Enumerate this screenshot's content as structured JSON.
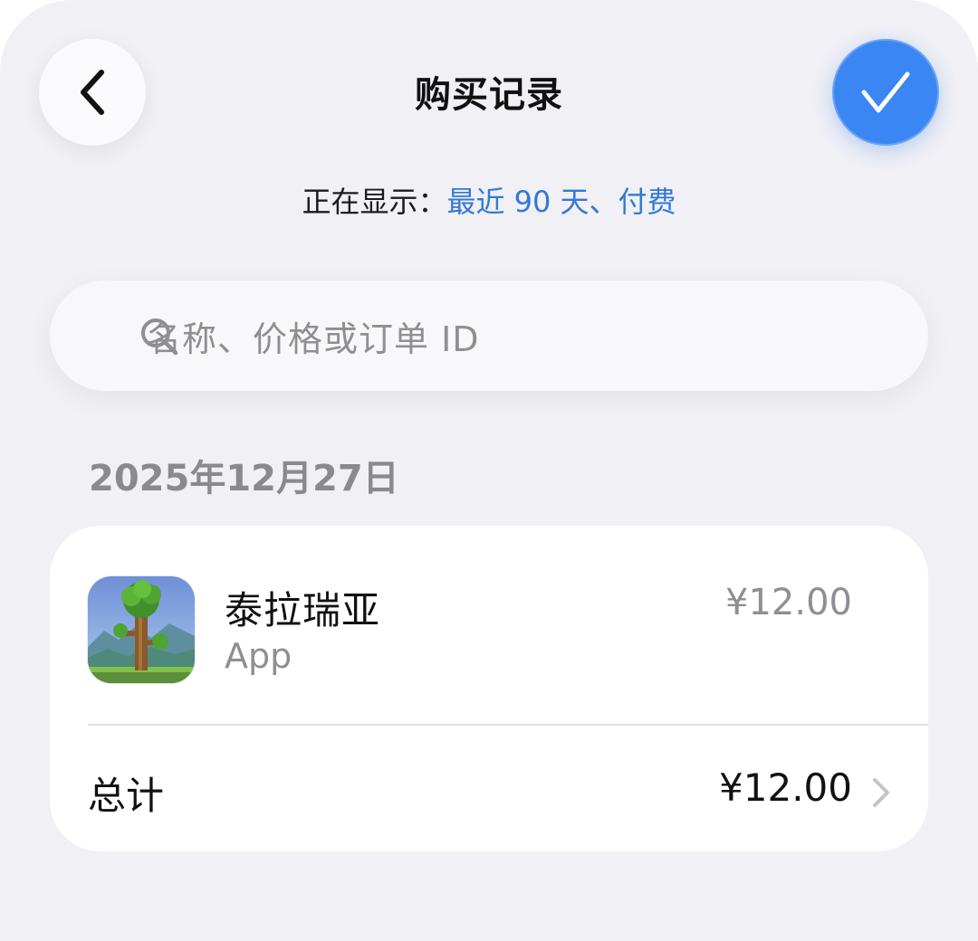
{
  "header": {
    "title": "购买记录",
    "back_icon": "chevron-left-icon",
    "done_icon": "checkmark-icon",
    "done_color": "#3a86f3"
  },
  "filter": {
    "label": "正在显示：",
    "value": "最近 90 天、付费",
    "value_color": "#3478d6"
  },
  "search": {
    "icon": "search-icon",
    "placeholder": "名称、价格或订单 ID"
  },
  "purchases": [
    {
      "date": "2025年12月27日",
      "items": [
        {
          "name": "泰拉瑞亚",
          "type": "App",
          "price": "¥12.00",
          "icon": "terraria-app-icon"
        }
      ],
      "total_label": "总计",
      "total_value": "¥12.00",
      "total_icon": "chevron-right-icon"
    }
  ]
}
